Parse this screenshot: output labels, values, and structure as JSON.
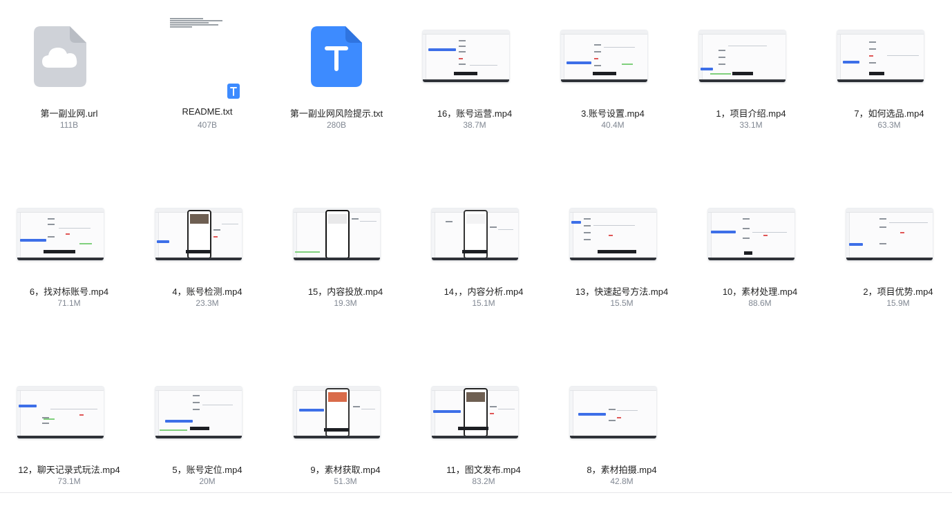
{
  "files": [
    {
      "name": "第一副业网.url",
      "size": "111B",
      "type": "url-file",
      "icon": "cloud-file-icon"
    },
    {
      "name": "README.txt",
      "size": "407B",
      "type": "readme",
      "icon": "text-file-icon"
    },
    {
      "name": "第一副业网风险提示.txt",
      "size": "280B",
      "type": "txt-file",
      "icon": "text-file-icon"
    },
    {
      "name": "16，账号运营.mp4",
      "size": "38.7M",
      "type": "video"
    },
    {
      "name": "3.账号设置.mp4",
      "size": "40.4M",
      "type": "video"
    },
    {
      "name": "1，项目介绍.mp4",
      "size": "33.1M",
      "type": "video"
    },
    {
      "name": "7，如何选品.mp4",
      "size": "63.3M",
      "type": "video"
    },
    {
      "name": "6，找对标账号.mp4",
      "size": "71.1M",
      "type": "video"
    },
    {
      "name": "4，账号检测.mp4",
      "size": "23.3M",
      "type": "video-phone"
    },
    {
      "name": "15，内容投放.mp4",
      "size": "19.3M",
      "type": "video-phone"
    },
    {
      "name": "14，，内容分析.mp4",
      "size": "15.1M",
      "type": "video-phone"
    },
    {
      "name": "13，快速起号方法.mp4",
      "size": "15.5M",
      "type": "video"
    },
    {
      "name": "10，素材处理.mp4",
      "size": "88.6M",
      "type": "video"
    },
    {
      "name": "2，项目优势.mp4",
      "size": "15.9M",
      "type": "video"
    },
    {
      "name": "12，聊天记录式玩法.mp4",
      "size": "73.1M",
      "type": "video"
    },
    {
      "name": "5，账号定位.mp4",
      "size": "20M",
      "type": "video"
    },
    {
      "name": "9，素材获取.mp4",
      "size": "51.3M",
      "type": "video-phone"
    },
    {
      "name": "11，图文发布.mp4",
      "size": "83.2M",
      "type": "video-phone"
    },
    {
      "name": "8，素材拍摄.mp4",
      "size": "42.8M",
      "type": "video"
    }
  ],
  "colors": {
    "accent_blue": "#3d8bff",
    "icon_gray": "#cfd2d8",
    "caption_dark": "#1d1f23"
  }
}
